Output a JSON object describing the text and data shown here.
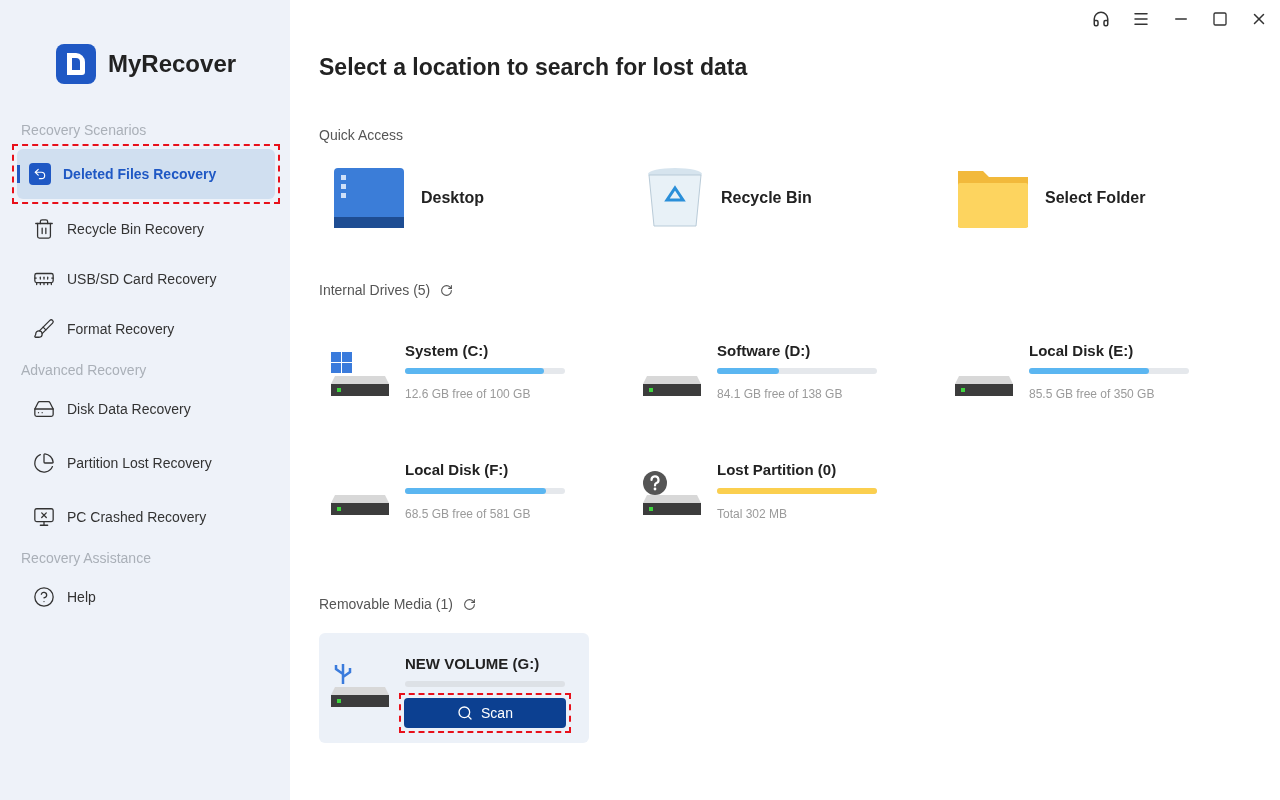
{
  "app": {
    "name": "MyRecover"
  },
  "sidebar": {
    "groups": [
      {
        "title": "Recovery Scenarios",
        "items": [
          {
            "label": "Deleted Files Recovery",
            "kind": "deleted",
            "selected": true,
            "highlighted": true
          },
          {
            "label": "Recycle Bin Recovery",
            "kind": "bin",
            "selected": false,
            "highlighted": false
          },
          {
            "label": "USB/SD Card Recovery",
            "kind": "sd",
            "selected": false,
            "highlighted": false
          },
          {
            "label": "Format Recovery",
            "kind": "format",
            "selected": false,
            "highlighted": false
          }
        ]
      },
      {
        "title": "Advanced Recovery",
        "items": [
          {
            "label": "Disk Data Recovery",
            "kind": "disk",
            "selected": false,
            "highlighted": false
          },
          {
            "label": "Partition Lost Recovery",
            "kind": "partition",
            "selected": false,
            "highlighted": false
          },
          {
            "label": "PC Crashed Recovery",
            "kind": "crash",
            "selected": false,
            "highlighted": false
          }
        ]
      },
      {
        "title": "Recovery Assistance",
        "items": [
          {
            "label": "Help",
            "kind": "help",
            "selected": false,
            "highlighted": false
          }
        ]
      }
    ]
  },
  "main": {
    "title": "Select a location to search for lost data",
    "quick_access": {
      "title": "Quick Access",
      "items": [
        {
          "label": "Desktop",
          "kind": "desktop"
        },
        {
          "label": "Recycle Bin",
          "kind": "bin"
        },
        {
          "label": "Select Folder",
          "kind": "folder"
        }
      ]
    },
    "internal_drives": {
      "title": "Internal Drives (5)",
      "drives": [
        {
          "name": "System (C:)",
          "kind": "system",
          "level": 0.87,
          "info": "12.6 GB free of 100 GB"
        },
        {
          "name": "Software (D:)",
          "kind": "disk",
          "level": 0.39,
          "info": "84.1 GB free of 138 GB"
        },
        {
          "name": "Local Disk (E:)",
          "kind": "disk",
          "level": 0.75,
          "info": "85.5 GB free of 350 GB"
        },
        {
          "name": "Local Disk (F:)",
          "kind": "disk",
          "level": 0.88,
          "info": "68.5 GB free of 581 GB"
        },
        {
          "name": "Lost Partition (0)",
          "kind": "lost",
          "level": 1,
          "info": "Total 302 MB"
        }
      ]
    },
    "removable_media": {
      "title": "Removable Media (1)",
      "drives": [
        {
          "name": "NEW VOLUME (G:)",
          "kind": "usb",
          "button": {
            "label": "Scan",
            "highlighted": true
          }
        }
      ]
    }
  }
}
